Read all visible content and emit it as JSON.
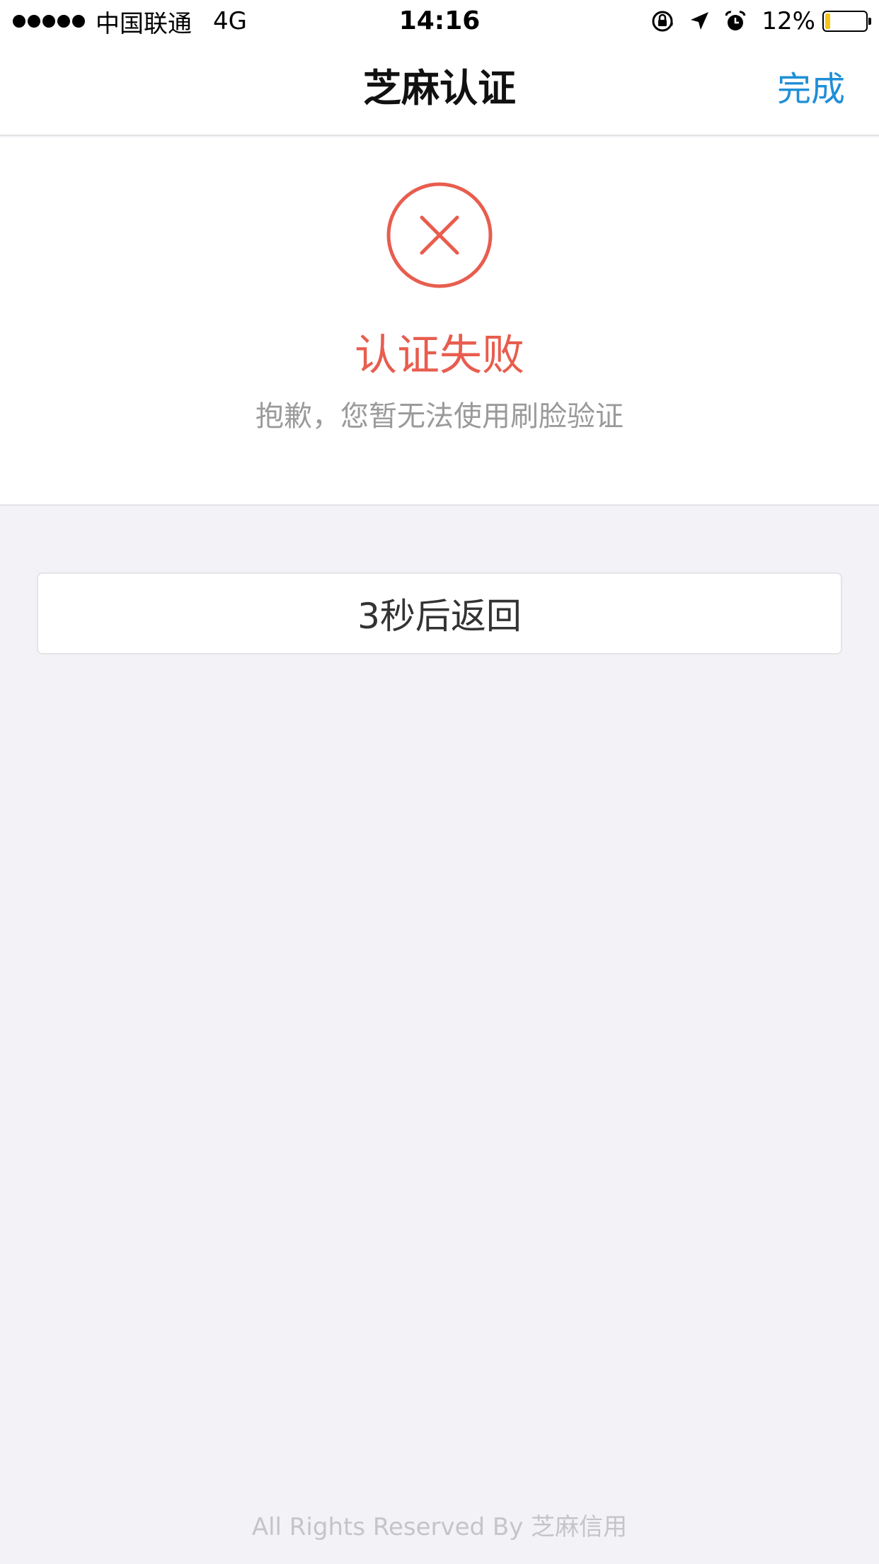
{
  "status_bar": {
    "carrier": "中国联通",
    "network": "4G",
    "time": "14:16",
    "battery_percent_label": "12%",
    "battery_level": 0.12,
    "icons": [
      "signal-dots-icon",
      "orientation-lock-icon",
      "location-arrow-icon",
      "alarm-icon",
      "battery-icon"
    ]
  },
  "nav": {
    "title": "芝麻认证",
    "done_label": "完成"
  },
  "result": {
    "icon": "fail-x-circle-icon",
    "title": "认证失败",
    "description": "抱歉，您暂无法使用刷脸验证"
  },
  "countdown": {
    "label": "3秒后返回"
  },
  "footer": {
    "text": "All Rights Reserved By 芝麻信用"
  },
  "colors": {
    "error": "#e85d4e",
    "link": "#1f8fd7",
    "background": "#f3f3f7",
    "battery_fill": "#f5c518"
  }
}
